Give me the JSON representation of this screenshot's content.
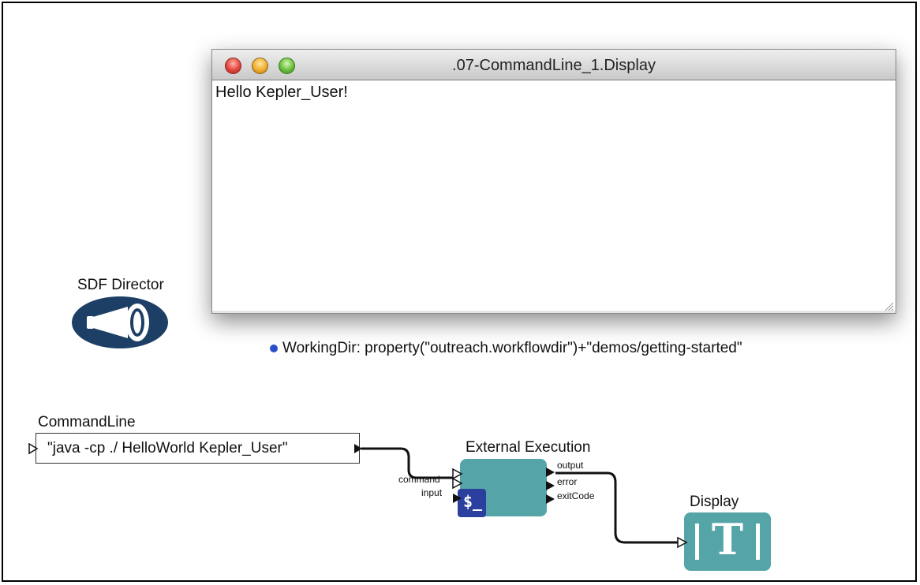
{
  "display_window": {
    "title": ".07-CommandLine_1.Display",
    "content": "Hello Kepler_User!"
  },
  "director": {
    "label": "SDF Director",
    "icon": "megaphone-icon"
  },
  "parameter": {
    "text": "WorkingDir: property(\"outreach.workflowdir\")+\"demos/getting-started\""
  },
  "command_line_actor": {
    "label": "CommandLine",
    "value": "\"java -cp ./ HelloWorld Kepler_User\""
  },
  "external_execution_actor": {
    "label": "External Execution",
    "input_ports": [
      "command",
      "input"
    ],
    "output_ports": [
      "output",
      "error",
      "exitCode"
    ],
    "icon": "terminal-icon",
    "icon_text": "$_"
  },
  "display_actor": {
    "label": "Display",
    "icon": "text-display-icon",
    "icon_text": "T"
  },
  "colors": {
    "actor_teal": "#55a4a8",
    "director_navy": "#1d3f66",
    "terminal_blue": "#2b3f9e",
    "parameter_dot": "#2a4fc9"
  }
}
